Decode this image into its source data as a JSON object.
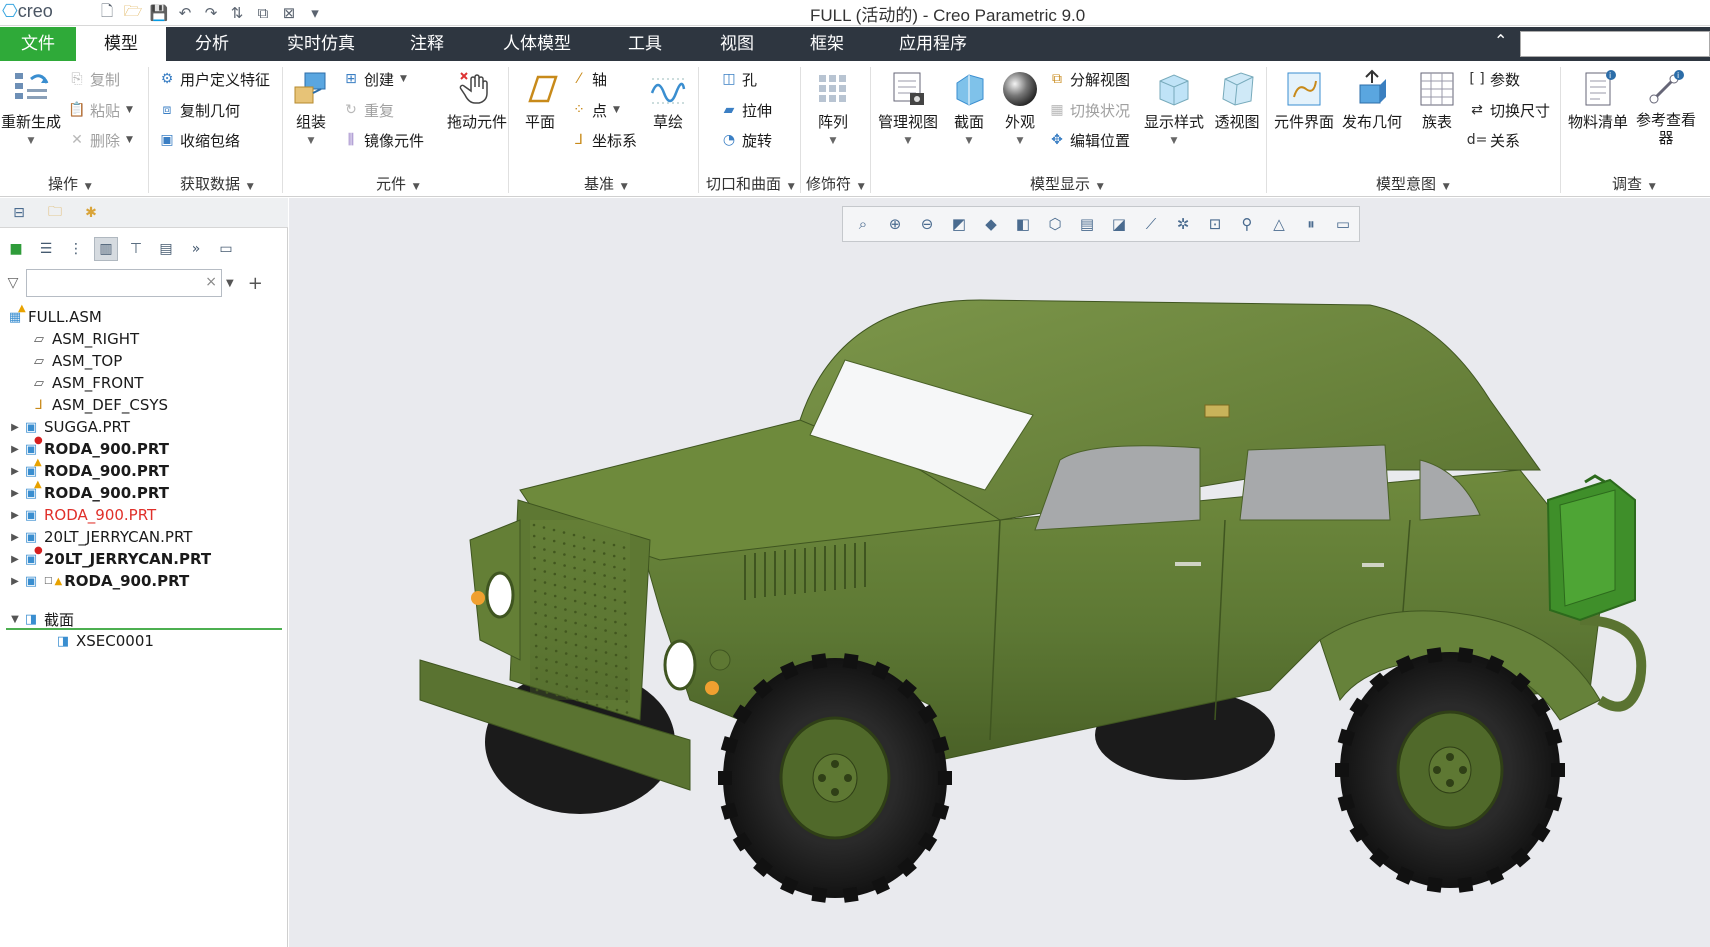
{
  "app": {
    "logo": "creo",
    "title": "FULL (活动的) - Creo Parametric 9.0"
  },
  "menu": {
    "file": "文件",
    "tabs": [
      "模型",
      "分析",
      "实时仿真",
      "注释",
      "人体模型",
      "工具",
      "视图",
      "框架",
      "应用程序"
    ],
    "active_tab": "模型"
  },
  "ribbon": {
    "groups": {
      "operations": "操作",
      "get_data": "获取数据",
      "component": "元件",
      "datum": "基准",
      "cut_surface": "切口和曲面",
      "modifiers": "修饰符",
      "model_display": "模型显示",
      "model_intent": "模型意图",
      "investigate": "调查"
    },
    "buttons": {
      "regenerate": "重新生成",
      "copy": "复制",
      "paste": "粘贴",
      "delete": "删除",
      "udf": "用户定义特征",
      "copy_geom": "复制几何",
      "shrinkwrap": "收缩包络",
      "assemble": "组装",
      "create": "创建",
      "repeat": "重复",
      "mirror": "镜像元件",
      "drag": "拖动元件",
      "plane": "平面",
      "axis": "轴",
      "point": "点",
      "csys": "坐标系",
      "sketch": "草绘",
      "hole": "孔",
      "extrude": "拉伸",
      "revolve": "旋转",
      "pattern": "阵列",
      "manage_views": "管理视图",
      "section": "截面",
      "appearance": "外观",
      "explode": "分解视图",
      "toggle_status": "切换状况",
      "edit_position": "编辑位置",
      "display_style": "显示样式",
      "perspective": "透视图",
      "component_interface": "元件界面",
      "publish_geom": "发布几何",
      "family_table": "族表",
      "parameters": "参数",
      "switch_dims": "切换尺寸",
      "relations": "关系",
      "bom": "物料清单",
      "ref_viewer": "参考查看器"
    }
  },
  "model_tree": {
    "root": "FULL.ASM",
    "items": [
      {
        "label": "ASM_RIGHT",
        "type": "plane"
      },
      {
        "label": "ASM_TOP",
        "type": "plane"
      },
      {
        "label": "ASM_FRONT",
        "type": "plane"
      },
      {
        "label": "ASM_DEF_CSYS",
        "type": "csys"
      },
      {
        "label": "SUGGA.PRT",
        "type": "part"
      },
      {
        "label": "RODA_900.PRT",
        "type": "part",
        "status": "error"
      },
      {
        "label": "RODA_900.PRT",
        "type": "part",
        "status": "warning"
      },
      {
        "label": "RODA_900.PRT",
        "type": "part",
        "status": "warning"
      },
      {
        "label": "RODA_900.PRT",
        "type": "part",
        "status": "red"
      },
      {
        "label": "20LT_JERRYCAN.PRT",
        "type": "part"
      },
      {
        "label": "20LT_JERRYCAN.PRT",
        "type": "part",
        "status": "error"
      },
      {
        "label": "RODA_900.PRT",
        "type": "part",
        "status": "warning"
      }
    ],
    "sections_folder": "截面",
    "section_item": "XSEC0001"
  },
  "colors": {
    "menubar": "#2e3640",
    "file_tab": "#2faa39",
    "viewport_bg": "#e9eaee",
    "body_green": "#5f7a33",
    "tire": "#1e1e1e",
    "accent_blue": "#3a8ed0"
  }
}
